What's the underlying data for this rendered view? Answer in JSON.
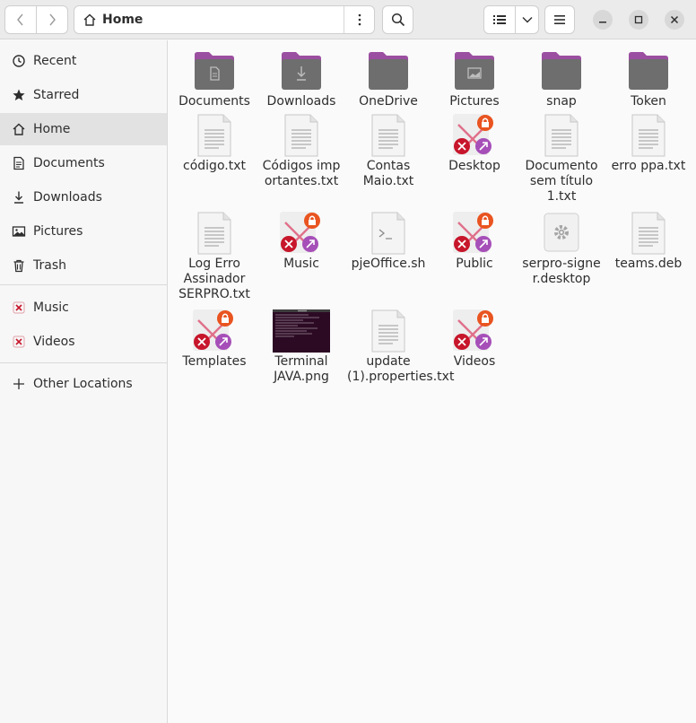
{
  "header": {
    "location": "Home",
    "icons": {
      "back": "chevron-left-icon",
      "forward": "chevron-right-icon",
      "home": "home-icon",
      "path_menu": "vertical-dots-icon",
      "search": "search-icon",
      "list_view": "list-view-icon",
      "view_chooser": "chevron-down-icon",
      "main_menu": "hamburger-icon",
      "minimize": "minimize-icon",
      "maximize": "maximize-icon",
      "close": "close-icon"
    }
  },
  "sidebar": {
    "items": [
      {
        "label": "Recent",
        "icon": "clock-icon"
      },
      {
        "label": "Starred",
        "icon": "star-icon"
      },
      {
        "label": "Home",
        "icon": "home-icon",
        "active": true
      },
      {
        "label": "Documents",
        "icon": "document-icon"
      },
      {
        "label": "Downloads",
        "icon": "download-icon"
      },
      {
        "label": "Pictures",
        "icon": "picture-icon"
      },
      {
        "label": "Trash",
        "icon": "trash-icon"
      },
      {
        "label": "Music",
        "icon": "broken-link-icon"
      },
      {
        "label": "Videos",
        "icon": "broken-link-icon"
      },
      {
        "label": "Other Locations",
        "icon": "plus-icon"
      }
    ]
  },
  "files": [
    {
      "name": "Documents",
      "kind": "folder-documents"
    },
    {
      "name": "Downloads",
      "kind": "folder-downloads"
    },
    {
      "name": "OneDrive",
      "kind": "folder"
    },
    {
      "name": "Pictures",
      "kind": "folder-pictures"
    },
    {
      "name": "snap",
      "kind": "folder"
    },
    {
      "name": "Token",
      "kind": "folder"
    },
    {
      "name": "código.txt",
      "kind": "text"
    },
    {
      "name": "Códigos importantes.txt",
      "kind": "text"
    },
    {
      "name": "Contas Maio.txt",
      "kind": "text"
    },
    {
      "name": "Desktop",
      "kind": "broken-symlink"
    },
    {
      "name": "Documento sem título 1.txt",
      "kind": "text"
    },
    {
      "name": "erro ppa.txt",
      "kind": "text"
    },
    {
      "name": "Log Erro Assinador SERPRO.txt",
      "kind": "text"
    },
    {
      "name": "Music",
      "kind": "broken-symlink"
    },
    {
      "name": "pjeOffice.sh",
      "kind": "script"
    },
    {
      "name": "Public",
      "kind": "broken-symlink"
    },
    {
      "name": "serpro-signer.desktop",
      "kind": "desktop"
    },
    {
      "name": "teams.deb",
      "kind": "text"
    },
    {
      "name": "Templates",
      "kind": "broken-symlink"
    },
    {
      "name": "Terminal JAVA.png",
      "kind": "image-thumbnail"
    },
    {
      "name": "update (1).properties.txt",
      "kind": "text"
    },
    {
      "name": "Videos",
      "kind": "broken-symlink"
    }
  ],
  "colors": {
    "folder_tab": "#9b4fa0",
    "folder_body": "#6e6e6e",
    "symlink_red": "#c7162b",
    "symlink_orange": "#e95420",
    "symlink_purple": "#a64fb8"
  }
}
